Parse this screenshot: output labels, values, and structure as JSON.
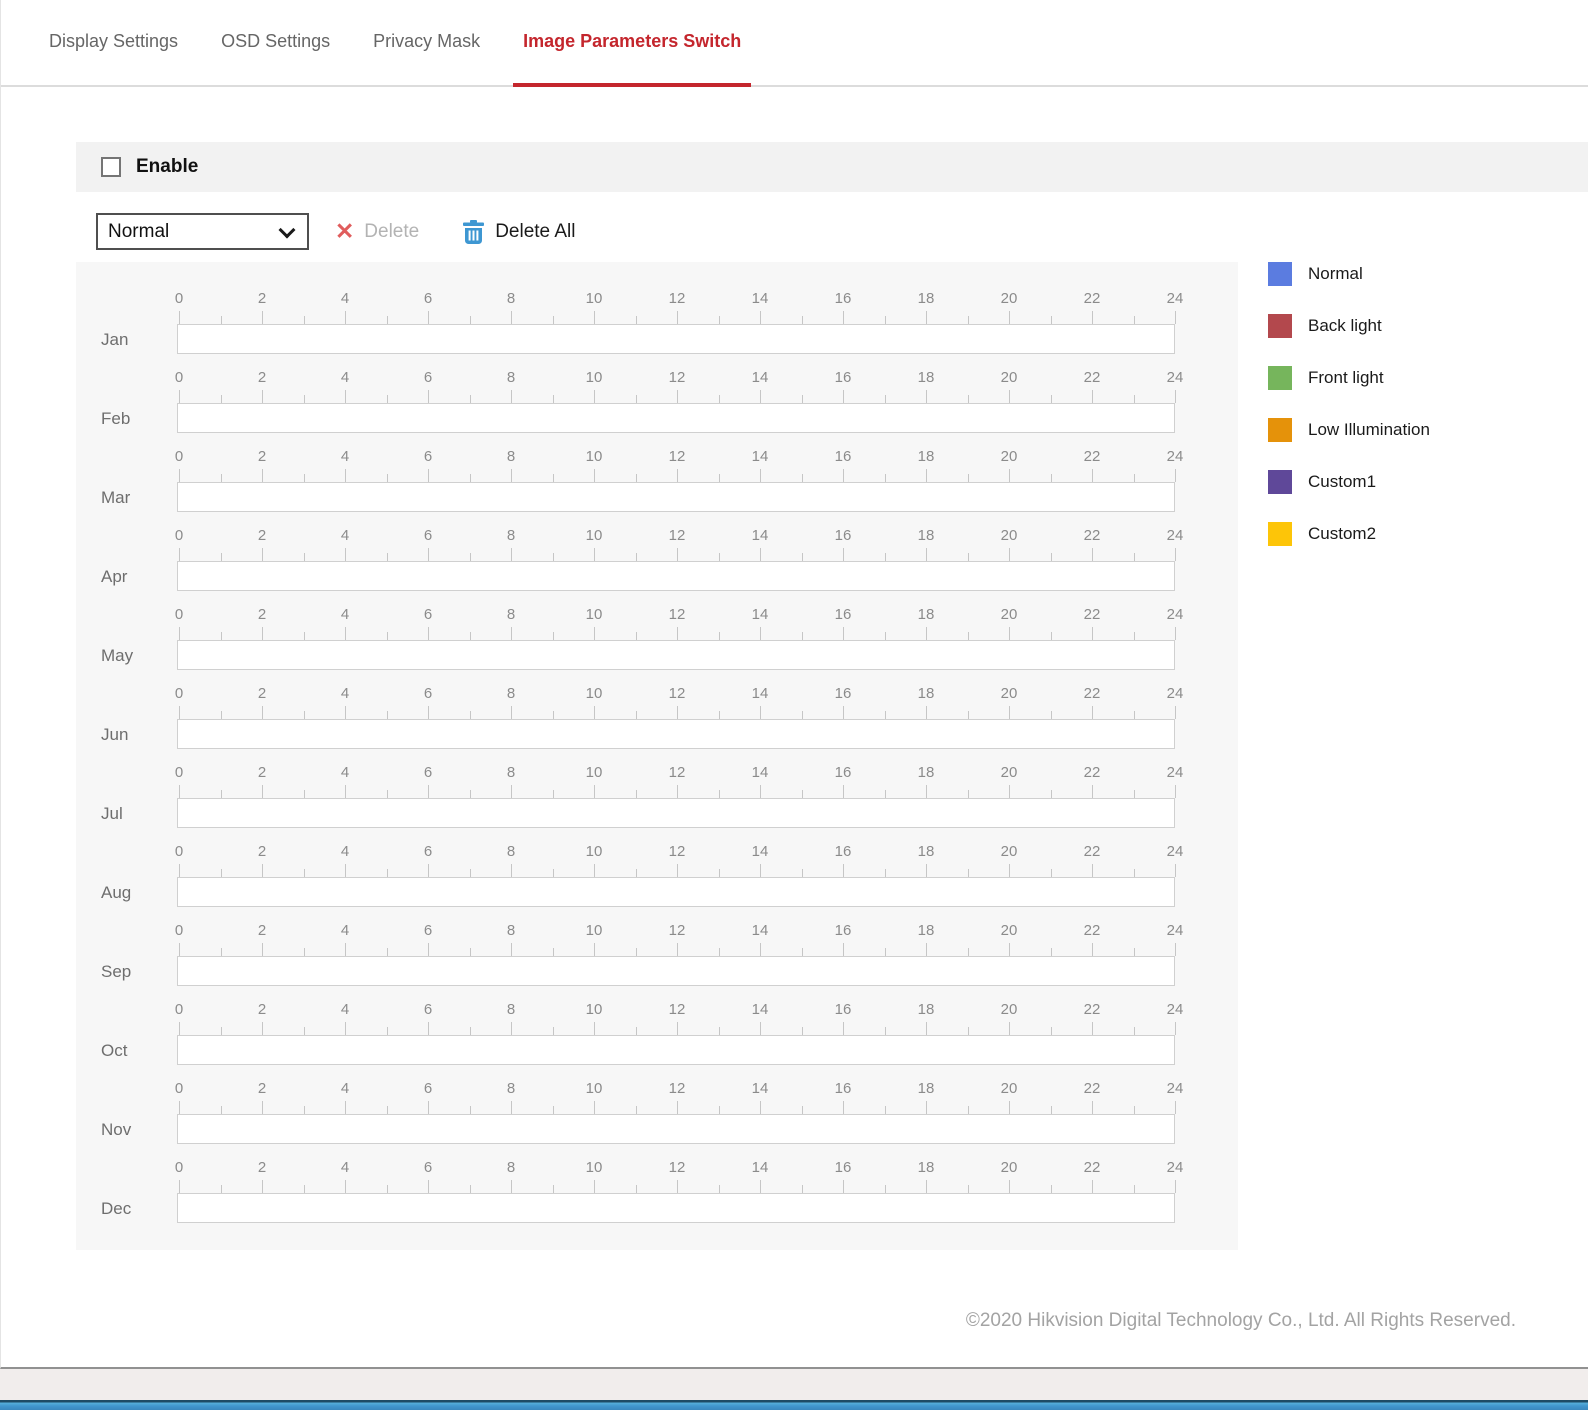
{
  "tabs": [
    {
      "label": "Display Settings",
      "active": false
    },
    {
      "label": "OSD Settings",
      "active": false
    },
    {
      "label": "Privacy Mask",
      "active": false
    },
    {
      "label": "Image Parameters Switch",
      "active": true
    }
  ],
  "enable": {
    "label": "Enable",
    "checked": false
  },
  "toolbar": {
    "mode_select": {
      "value": "Normal"
    },
    "delete": {
      "label": "Delete",
      "enabled": false
    },
    "delete_all": {
      "label": "Delete All",
      "enabled": true
    }
  },
  "schedule": {
    "months": [
      "Jan",
      "Feb",
      "Mar",
      "Apr",
      "May",
      "Jun",
      "Jul",
      "Aug",
      "Sep",
      "Oct",
      "Nov",
      "Dec"
    ],
    "hour_labels": [
      "0",
      "2",
      "4",
      "6",
      "8",
      "10",
      "12",
      "14",
      "16",
      "18",
      "20",
      "22",
      "24"
    ],
    "hours_start": 0,
    "hours_end": 24,
    "segments": []
  },
  "legend": [
    {
      "label": "Normal",
      "color": "#5b7ce0"
    },
    {
      "label": "Back light",
      "color": "#b3484d"
    },
    {
      "label": "Front light",
      "color": "#76b55c"
    },
    {
      "label": "Low Illumination",
      "color": "#e5920a"
    },
    {
      "label": "Custom1",
      "color": "#5f4899"
    },
    {
      "label": "Custom2",
      "color": "#fdc508"
    }
  ],
  "footer": {
    "copyright": "©2020 Hikvision Digital Technology Co., Ltd. All Rights Reserved."
  },
  "colors": {
    "accent_red": "#c4262d",
    "delete_x": "#e05d5d",
    "trash_blue": "#3e97d2",
    "taskbar_blue": "#4196ce"
  }
}
